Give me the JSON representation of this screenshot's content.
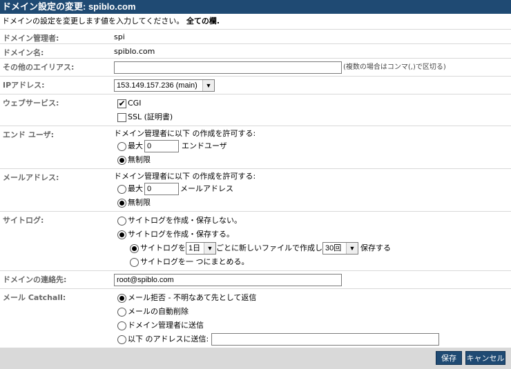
{
  "title": "ドメイン設定の変更: spiblo.com",
  "intro": {
    "text": "ドメインの設定を変更します値を入力してください。",
    "bold": "全ての欄."
  },
  "rows": {
    "admin": {
      "label": "ドメイン管理者:",
      "value": "spi"
    },
    "domain": {
      "label": "ドメイン名:",
      "value": "spiblo.com"
    },
    "alias": {
      "label": "その他のエイリアス:",
      "value": "",
      "hint": "(複数の場合はコンマ(,)で区切る)"
    },
    "ip": {
      "label": "IPアドレス:",
      "selected": "153.149.157.236 (main)"
    },
    "web": {
      "label": "ウェブサービス:",
      "cgi": "CGI",
      "cgi_checked": true,
      "ssl": "SSL (証明書)",
      "ssl_checked": false
    },
    "endusers": {
      "label": "エンド ユーザ:",
      "allow": "ドメイン管理者に以下 の作成を許可する:",
      "max": "最大",
      "max_value": "0",
      "unit": "エンドユーザ",
      "unlimited": "無制限"
    },
    "mail": {
      "label": "メールアドレス:",
      "allow": "ドメイン管理者に以下 の作成を許可する:",
      "max": "最大",
      "max_value": "0",
      "unit": "メールアドレス",
      "unlimited": "無制限"
    },
    "sitelog": {
      "label": "サイトログ:",
      "opt_none": "サイトログを作成・保存しない。",
      "opt_save": "サイトログを作成・保存する。",
      "per_prefix": "サイトログを",
      "per_value": "1日",
      "per_mid": "ごとに新しいファイルで作成し",
      "keep_value": "30回",
      "keep_suffix": "保存する",
      "opt_one": "サイトログを一 つにまとめる。"
    },
    "contact": {
      "label": "ドメインの連絡先:",
      "value": "root@spiblo.com"
    },
    "catchall": {
      "label": "メール Catchall:",
      "opt1": "メール拒否 - 不明なあて先として返信",
      "opt2": "メールの自動削除",
      "opt3": "ドメイン管理者に送信",
      "opt4": "以下 のアドレスに送信:",
      "opt4_value": ""
    }
  },
  "buttons": {
    "save": "保存",
    "cancel": "キャンセル"
  }
}
